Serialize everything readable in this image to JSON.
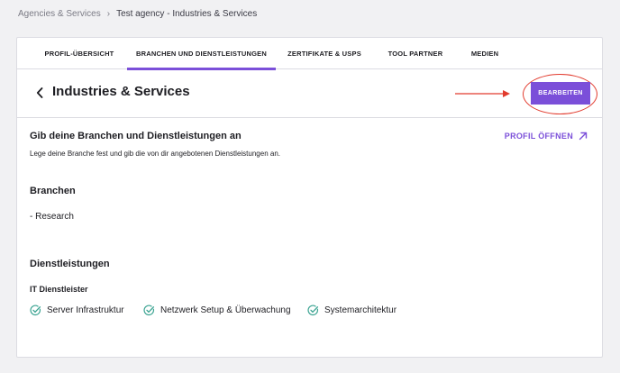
{
  "breadcrumb": {
    "parent": "Agencies & Services",
    "separator": "›",
    "current": "Test agency - Industries & Services"
  },
  "tabs": [
    {
      "label": "PROFIL-ÜBERSICHT",
      "active": false
    },
    {
      "label": "BRANCHEN UND DIENSTLEISTUNGEN",
      "active": true
    },
    {
      "label": "ZERTIFIKATE & USPS",
      "active": false
    },
    {
      "label": "TOOL PARTNER",
      "active": false
    },
    {
      "label": "MEDIEN",
      "active": false
    }
  ],
  "header": {
    "title": "Industries & Services",
    "edit_button": "BEARBEITEN"
  },
  "section": {
    "title": "Gib deine Branchen und Dienstleistungen an",
    "description": "Lege deine Branche fest und gib die von dir angebotenen Dienstleistungen an.",
    "open_profile": "PROFIL ÖFFNEN"
  },
  "branchen": {
    "heading": "Branchen",
    "value": "- Research"
  },
  "dienstleistungen": {
    "heading": "Dienstleistungen",
    "group": "IT Dienstleister",
    "items": [
      "Server Infrastruktur",
      "Netzwerk Setup & Überwachung",
      "Systemarchitektur"
    ]
  },
  "colors": {
    "accent": "#7b4fd9",
    "annotation": "#e23b2e",
    "check": "#3aa391"
  }
}
